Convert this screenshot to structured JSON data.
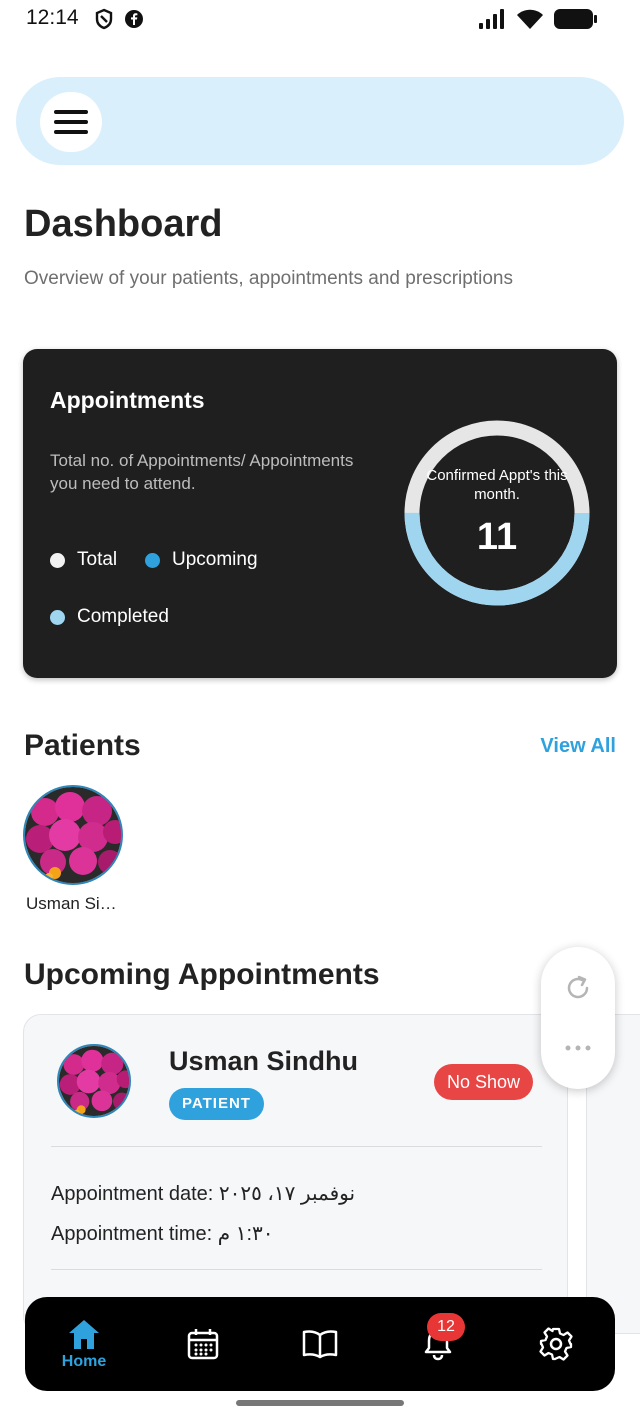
{
  "status_bar": {
    "time": "12:14"
  },
  "topbar": {
    "menu_icon": "hamburger-menu-icon"
  },
  "page": {
    "title": "Dashboard",
    "subtitle": "Overview of your patients, appointments and prescriptions"
  },
  "appointments_card": {
    "title": "Appointments",
    "description": "Total no. of Appointments/ Appointments you need to attend.",
    "legend": [
      {
        "label": "Total",
        "color": "#f2f2f2"
      },
      {
        "label": "Upcoming",
        "color": "#2fa2de"
      },
      {
        "label": "Completed",
        "color": "#9fd5ef"
      }
    ],
    "ring_label": "Confirmed Appt's this month.",
    "ring_value": "11",
    "ring_colors": {
      "track": "#e6e6e6",
      "completed": "#9fd5ef"
    },
    "ring_completed_fraction": 0.5
  },
  "patients": {
    "title": "Patients",
    "view_all": "View All",
    "items": [
      {
        "name": "Usman Si…"
      }
    ]
  },
  "upcoming": {
    "title": "Upcoming Appointments",
    "card": {
      "name": "Usman Sindhu",
      "badge": "PATIENT",
      "status": "No Show",
      "date_label": "Appointment date:",
      "date_value": "نوفمبر ١٧، ٢٠٢٥",
      "time_label": "Appointment time:",
      "time_value": "١:٣٠ م"
    }
  },
  "bottom_nav": {
    "home_label": "Home",
    "notification_count": "12",
    "active_color": "#2fa2de"
  }
}
